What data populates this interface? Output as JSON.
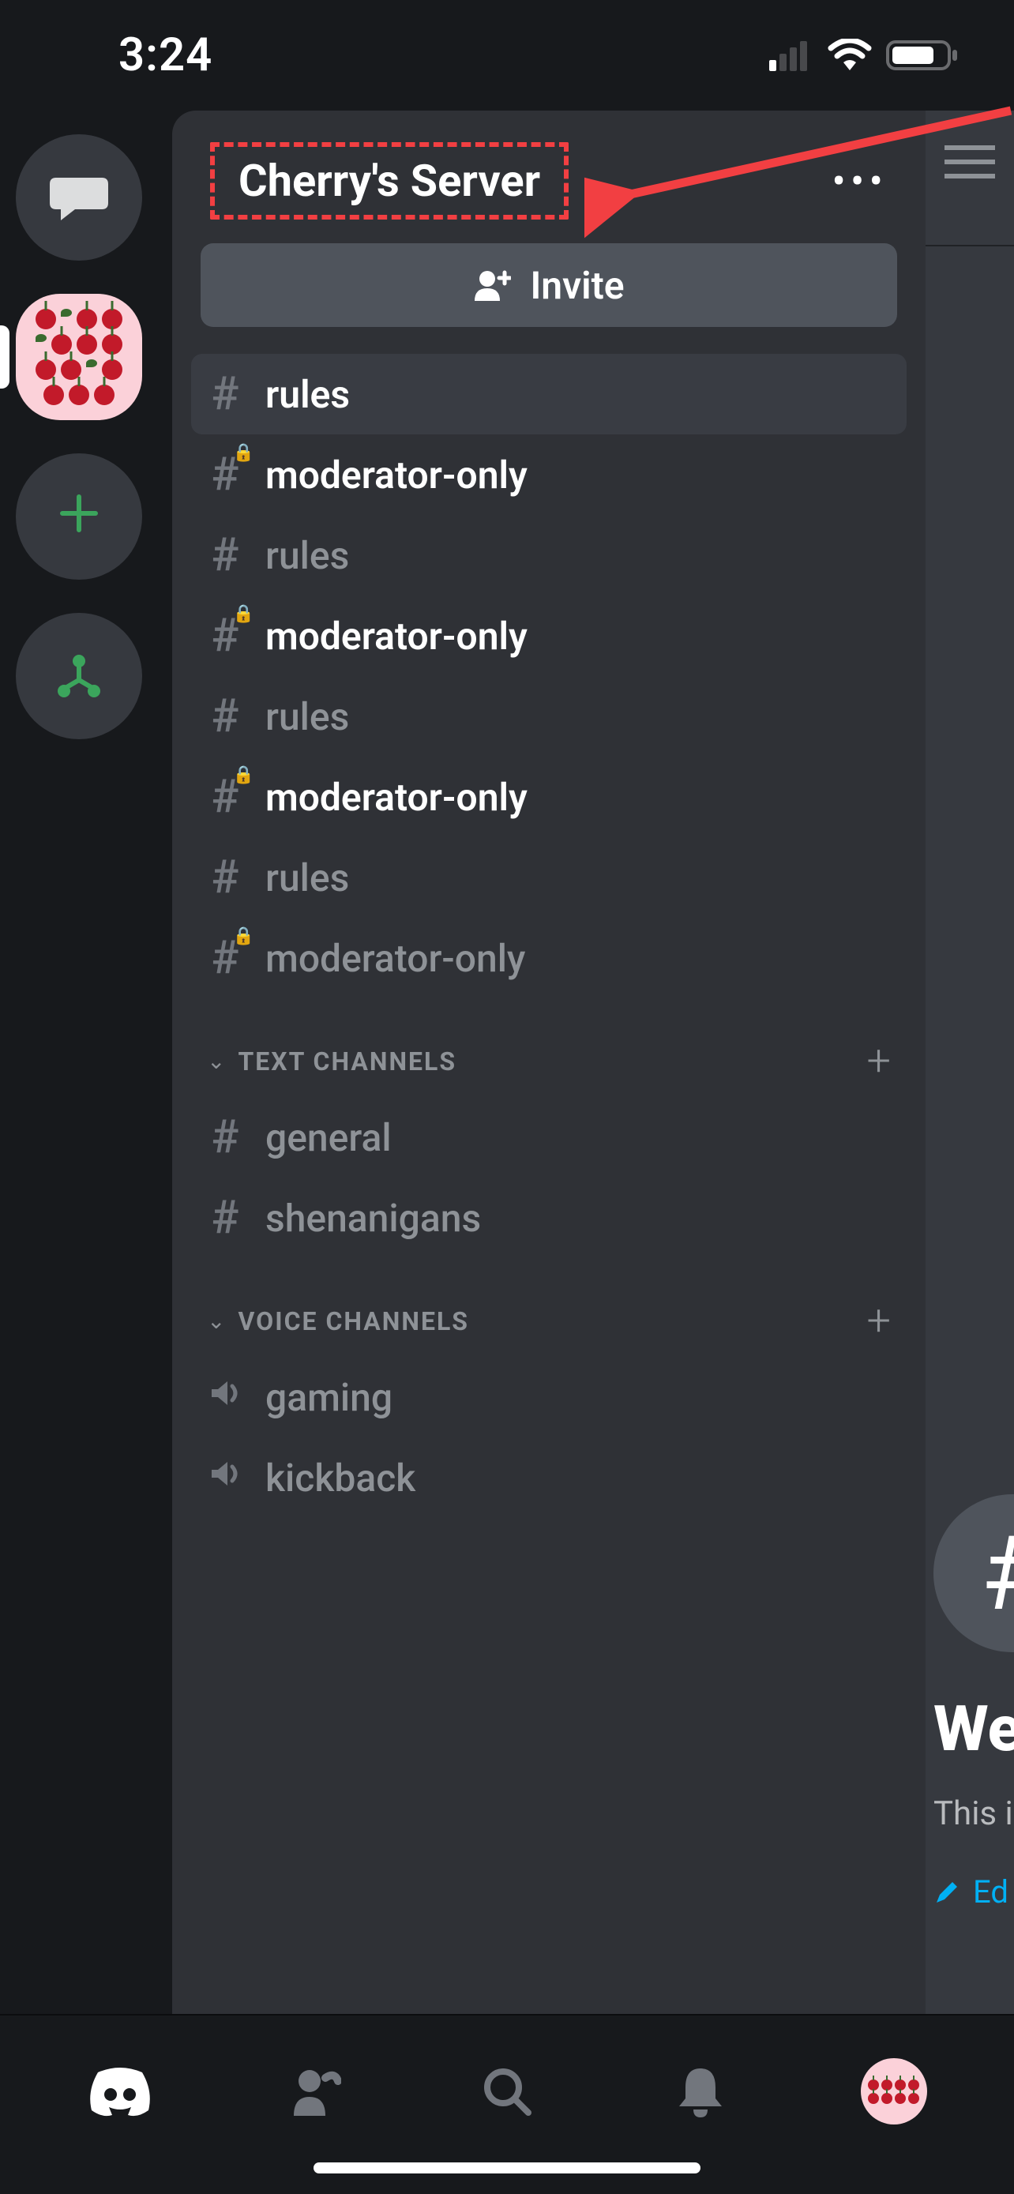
{
  "status": {
    "time": "3:24"
  },
  "server": {
    "name": "Cherry's Server",
    "invite_label": "Invite"
  },
  "channels_top": [
    {
      "name": "rules",
      "locked": false,
      "bright": true,
      "selected": true,
      "pip": false
    },
    {
      "name": "moderator-only",
      "locked": true,
      "bright": true,
      "selected": false,
      "pip": true
    },
    {
      "name": "rules",
      "locked": false,
      "bright": false,
      "selected": false,
      "pip": false
    },
    {
      "name": "moderator-only",
      "locked": true,
      "bright": true,
      "selected": false,
      "pip": true
    },
    {
      "name": "rules",
      "locked": false,
      "bright": false,
      "selected": false,
      "pip": false
    },
    {
      "name": "moderator-only",
      "locked": true,
      "bright": true,
      "selected": false,
      "pip": true
    },
    {
      "name": "rules",
      "locked": false,
      "bright": false,
      "selected": false,
      "pip": false
    },
    {
      "name": "moderator-only",
      "locked": true,
      "bright": false,
      "selected": false,
      "pip": false
    }
  ],
  "categories": [
    {
      "label": "TEXT CHANNELS",
      "channels": [
        {
          "name": "general",
          "type": "text"
        },
        {
          "name": "shenanigans",
          "type": "text"
        }
      ]
    },
    {
      "label": "VOICE CHANNELS",
      "channels": [
        {
          "name": "gaming",
          "type": "voice"
        },
        {
          "name": "kickback",
          "type": "voice"
        }
      ]
    }
  ],
  "sliver": {
    "welcome": "We",
    "sub": "This i",
    "edit": "Ed"
  },
  "annotation": {
    "highlight_color": "#f23f42"
  }
}
